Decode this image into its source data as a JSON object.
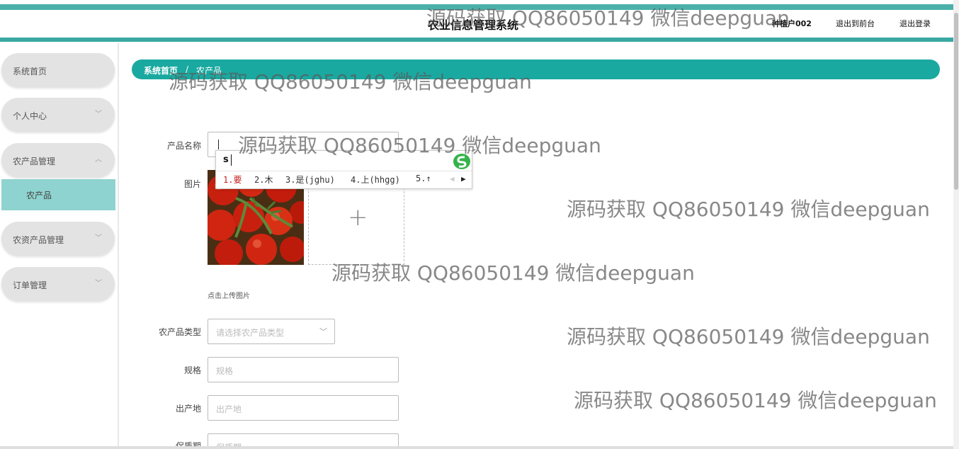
{
  "header": {
    "title": "农业信息管理系统",
    "user": "种植户002",
    "nav_front": "退出到前台",
    "nav_logout": "退出登录"
  },
  "sidebar": {
    "items": [
      {
        "label": "系统首页"
      },
      {
        "label": "个人中心"
      },
      {
        "label": "农产品管理"
      },
      {
        "label": "农资产品管理"
      },
      {
        "label": "订单管理"
      }
    ],
    "sub_items": [
      {
        "label": "农产品"
      }
    ]
  },
  "breadcrumb": {
    "home": "系统首页",
    "separator": "/",
    "current": "农产品"
  },
  "form": {
    "name_label": "产品名称",
    "image_label": "图片",
    "upload_hint": "点击上传图片",
    "type_label": "农产品类型",
    "type_placeholder": "请选择农产品类型",
    "spec_label": "规格",
    "spec_placeholder": "规格",
    "origin_label": "出产地",
    "origin_placeholder": "出产地",
    "shelf_label": "保质期",
    "shelf_placeholder": "保质期"
  },
  "ime": {
    "composition": "s",
    "candidates": [
      "1.要",
      "2.木",
      "3.是(jghu)",
      "4.上(hhgg)",
      "5.↑"
    ]
  },
  "watermark": "源码获取 QQ86050149 微信deepguan",
  "colors": {
    "accent": "#1aa9a0",
    "active_sub": "#8ed3cf",
    "header_line": "#3aa9a3"
  }
}
